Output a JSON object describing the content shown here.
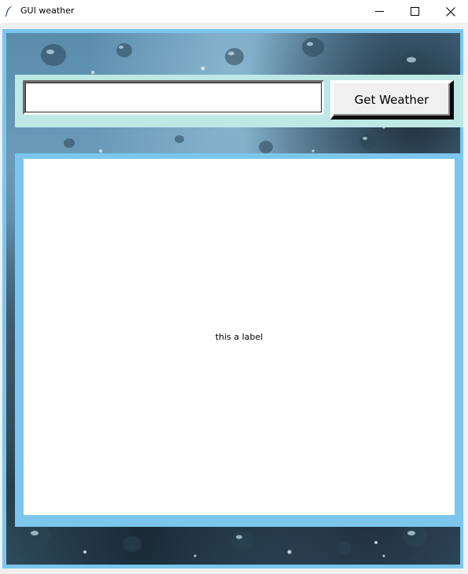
{
  "window": {
    "title": "GUI weather",
    "icon": "feather-icon",
    "controls": [
      "minimize-icon",
      "maximize-icon",
      "close-icon"
    ]
  },
  "search": {
    "value": "",
    "placeholder": ""
  },
  "button": {
    "label": "Get Weather"
  },
  "output": {
    "text": "this a label"
  },
  "colors": {
    "frame_border": "#7cc6ee",
    "top_frame_bg": "#bde8e4",
    "label_bg": "#ffffff",
    "button_bg": "#f0f0f0"
  }
}
